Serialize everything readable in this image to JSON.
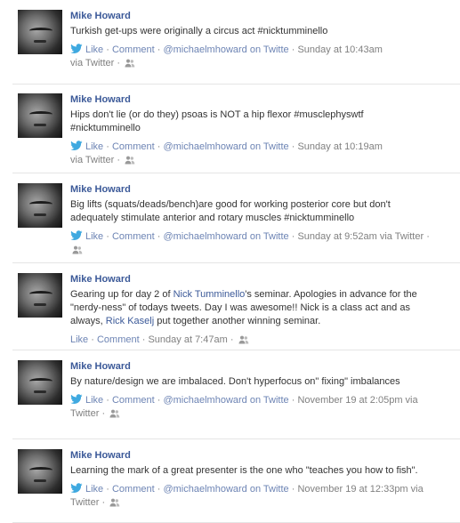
{
  "posts": [
    {
      "author": "Mike Howard",
      "text": "Turkish get-ups were originally a circus act #nicktumminello",
      "like": "Like",
      "comment": "Comment",
      "source": "@michaelmhoward on Twitte",
      "time": "Sunday at 10:43am",
      "via": "via Twitter"
    },
    {
      "author": "Mike Howard",
      "text": "Hips don't lie (or do they) psoas is NOT a hip flexor #musclephyswtf #nicktumminello",
      "like": "Like",
      "comment": "Comment",
      "source": "@michaelmhoward on Twitte",
      "time": "Sunday at 10:19am",
      "via": "via Twitter"
    },
    {
      "author": "Mike Howard",
      "text": "Big lifts (squats/deads/bench)are good for working posterior core but don't adequately stimulate anterior and rotary muscles #nicktumminello",
      "like": "Like",
      "comment": "Comment",
      "source": "@michaelmhoward on Twitte",
      "time": "Sunday at 9:52am",
      "via": "via Twitter"
    },
    {
      "author": "Mike Howard",
      "text_part1": "Gearing up for day 2 of ",
      "text_link1": "Nick Tumminello",
      "text_part2": "'s seminar. Apologies in advance for the \"nerdy-ness\" of todays tweets. Day I was awesome!! Nick is a class act and as always, ",
      "text_link2": "Rick Kaselj",
      "text_part3": " put together another winning seminar.",
      "like": "Like",
      "comment": "Comment",
      "time": "Sunday at 7:47am"
    },
    {
      "author": "Mike Howard",
      "text": "By nature/design we are imbalaced. Don't hyperfocus on\" fixing\" imbalances",
      "like": "Like",
      "comment": "Comment",
      "source": "@michaelmhoward on Twitte",
      "time": "November 19 at 2:05pm",
      "via": "via Twitter"
    },
    {
      "author": "Mike Howard",
      "text": "Learning the mark of a great presenter is the one who \"teaches you how to fish\".",
      "like": "Like",
      "comment": "Comment",
      "source": "@michaelmhoward on Twitte",
      "time": "November 19 at 12:33pm",
      "via": "via Twitter"
    }
  ],
  "separator": "·",
  "colors": {
    "link": "#3b5998",
    "action": "#6d84b4",
    "meta": "#808080",
    "twitter": "#3fa9e0"
  },
  "icons": {
    "source": "twitter-bird-icon",
    "audience": "friends-audience-icon"
  }
}
